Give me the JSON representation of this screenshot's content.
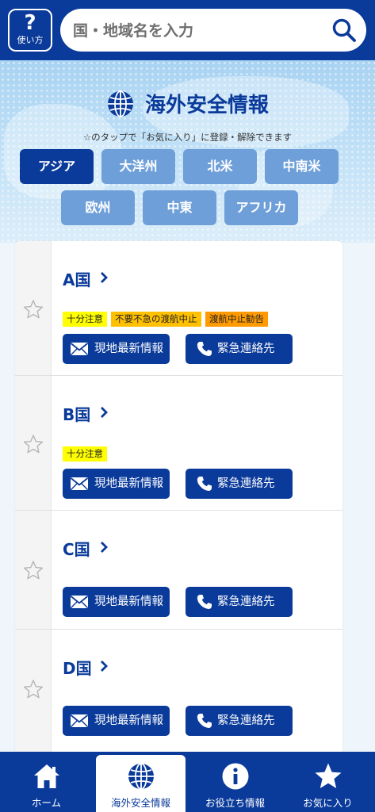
{
  "header": {
    "help_mark": "?",
    "help_label": "使い方",
    "search_placeholder": "国・地域名を入力"
  },
  "hero": {
    "title": "海外安全情報",
    "hint": "☆のタップで「お気に入り」に登録・解除できます"
  },
  "regions": [
    {
      "label": "アジア",
      "active": true
    },
    {
      "label": "大洋州",
      "active": false
    },
    {
      "label": "北米",
      "active": false
    },
    {
      "label": "中南米",
      "active": false
    },
    {
      "label": "欧州",
      "active": false
    },
    {
      "label": "中東",
      "active": false
    },
    {
      "label": "アフリカ",
      "active": false
    }
  ],
  "countries": [
    {
      "name": "A国",
      "tags": [
        "十分注意",
        "不要不急の渡航中止",
        "渡航中止勧告"
      ]
    },
    {
      "name": "B国",
      "tags": [
        "十分注意"
      ]
    },
    {
      "name": "C国",
      "tags": []
    },
    {
      "name": "D国",
      "tags": []
    }
  ],
  "buttons": {
    "local_info": "現地最新情報",
    "emergency": "緊急連絡先"
  },
  "bottom_nav": [
    {
      "label": "ホーム",
      "icon": "home-icon",
      "active": false
    },
    {
      "label": "海外安全情報",
      "icon": "globe-icon",
      "active": true
    },
    {
      "label": "お役立ち情報",
      "icon": "info-icon",
      "active": false
    },
    {
      "label": "お気に入り",
      "icon": "star-icon",
      "active": false
    }
  ],
  "colors": {
    "brand": "#0a3a9a",
    "region_inactive": "#6f9fd9",
    "tag_level1": "#ffff00",
    "tag_level2": "#ffc000",
    "tag_level3": "#ff9a00"
  }
}
